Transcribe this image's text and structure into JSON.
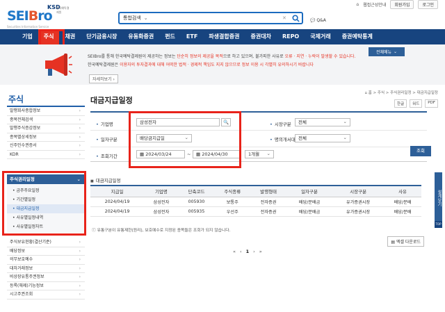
{
  "logo": {
    "main": "SEIBro",
    "ksd": "KSD",
    "ksd_sub": "한국예탁결제원",
    "tagline": "Securities Information Service"
  },
  "top_links": {
    "sitemap": "웹접근성안내",
    "join": "회원가입",
    "login": "로그인"
  },
  "search": {
    "category": "통합검색",
    "placeholder": "",
    "qna": "Q&A"
  },
  "nav": [
    "기업",
    "주식",
    "채권",
    "단기금융시장",
    "유동화증권",
    "펀드",
    "ETF",
    "파생결합증권",
    "증권대차",
    "REPO",
    "국제거래",
    "증권예탁통계"
  ],
  "banner": {
    "line1_a": "SEIBro를 통해 한국예탁결제원이 제공하는 정보는 ",
    "line1_b": "단순히 정보의 제공을 목적",
    "line1_c": "으로 하고 있으며, 불가피한 사유로 ",
    "line1_d": "오류 · 지연 · 누락이 발생할 수 있습니다.",
    "line2_a": "한국예탁결제원은 ",
    "line2_b": "이용자의 투자결과에 대해 어떠한 법적 · 경제적 책임도 지지 않으므로 정보 이용 시 각별히 유의하시기 바랍니다",
    "more": "자세히보기 ›",
    "all_menu": "전체메뉴"
  },
  "sidebar": {
    "title": "주식",
    "items": [
      "발행회사종합정보",
      "종목전체검색",
      "발행주식증감정보",
      "종목별상세정보",
      "신주인수권증서",
      "KDR"
    ],
    "active": "주식권리일정",
    "sub_items": [
      "금주주요일정",
      "기간별일정",
      "대금지급일정",
      "사유별일정내역",
      "사유별일정차트"
    ],
    "items2": [
      "주식보유현황(결산기준)",
      "배당정보",
      "의무보호예수",
      "대차거래정보",
      "비상장유통주권정보",
      "등록(해제)기능정보",
      "시고주권조회"
    ]
  },
  "page": {
    "title": "대금지급일정",
    "breadcrumb": "⌂ 홈 > 주식 > 주식권리일정 > 대금지급일정",
    "tools": [
      "한글",
      "워드",
      "PDF"
    ]
  },
  "form": {
    "company_label": "기업명",
    "company_value": "삼성전자",
    "market_label": "시장구분",
    "market_value": "전체",
    "date_type_label": "일자구분",
    "date_type_value": "배당금지급일",
    "agent_label": "명의개서대리인",
    "agent_value": "전체",
    "period_label": "조회기간",
    "date_from": "2024/03/24",
    "date_sep": "~",
    "date_to": "2024/04/30",
    "period_value": "1개월",
    "search_button": "조회"
  },
  "table": {
    "title": "대금지급일정",
    "headers": [
      "지급일",
      "기업명",
      "단축코드",
      "주식종류",
      "발행형태",
      "일자구분",
      "시장구분",
      "사유"
    ],
    "rows": [
      [
        "2024/04/19",
        "삼성전자",
        "005930",
        "보통주",
        "전자증권",
        "배당/분배금",
        "유가증권시장",
        "배당/분배"
      ],
      [
        "2024/04/19",
        "삼성전자",
        "005935",
        "우선주",
        "전자증권",
        "배당/분배금",
        "유가증권시장",
        "배당/분배"
      ]
    ],
    "note": "ⓘ 유통구분이 유통제한(원리), 보호예수로 지정된 종목들은 조회가 되지 않습니다.",
    "excel": "엑셀 다운로드",
    "pager": {
      "first": "«",
      "prev": "‹",
      "current": "1",
      "next": "›",
      "last": "»"
    }
  },
  "fab": {
    "label": "설계보기",
    "top": "TOP"
  },
  "colors": {
    "nav_bg": "#17447f",
    "accent_red": "#e63223",
    "primary_blue": "#2d5f98"
  }
}
